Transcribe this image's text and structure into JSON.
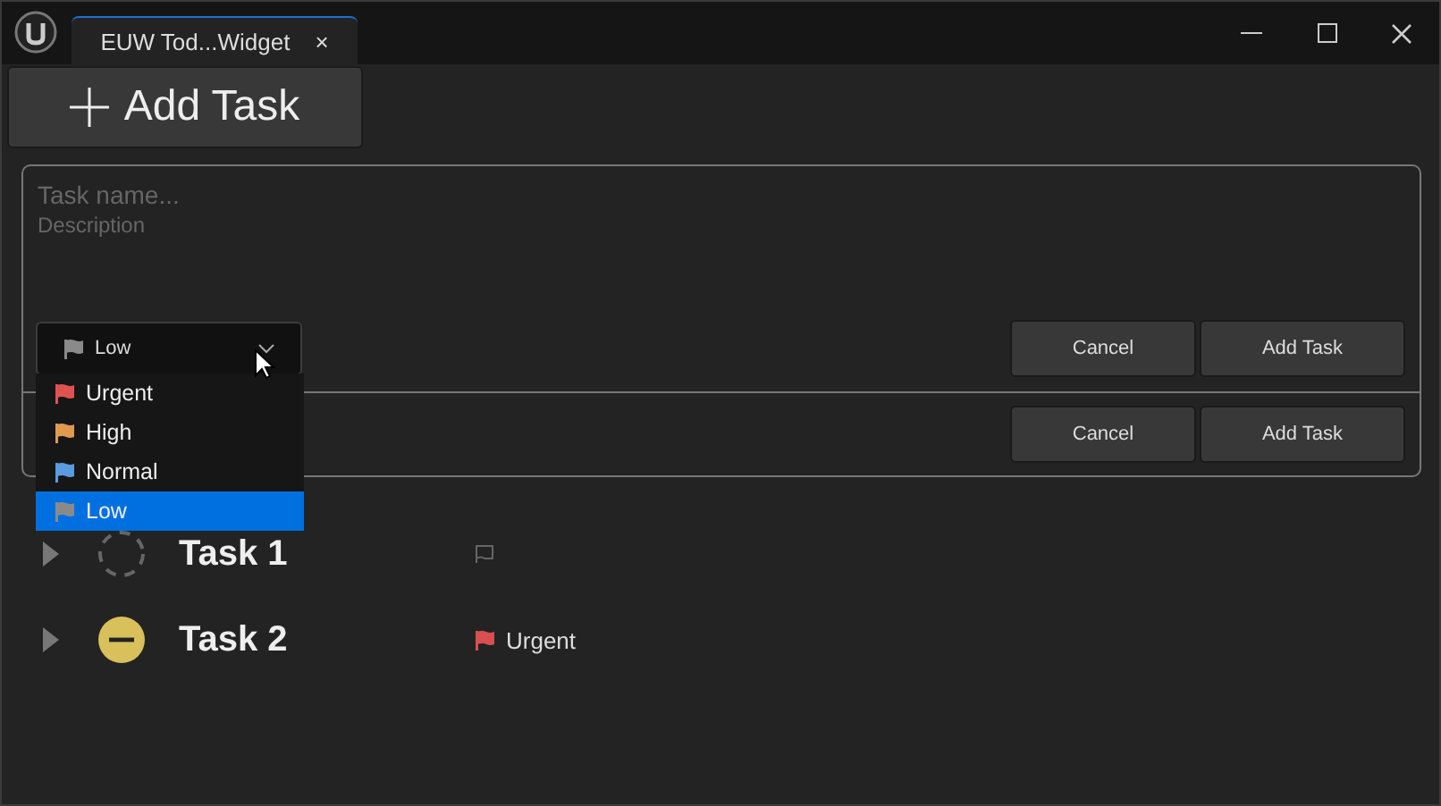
{
  "window": {
    "tab_title": "EUW Tod...Widget",
    "tab_close": "×"
  },
  "add_button": {
    "label": "Add Task"
  },
  "form": {
    "name_placeholder": "Task name...",
    "description_placeholder": "Description",
    "priority": {
      "value": "Low",
      "color": "#8a8a8a",
      "expanded": true,
      "options": [
        {
          "label": "Urgent",
          "color": "#e05252",
          "selected": false
        },
        {
          "label": "High",
          "color": "#e09a4f",
          "selected": false
        },
        {
          "label": "Normal",
          "color": "#5a9be0",
          "selected": false
        },
        {
          "label": "Low",
          "color": "#8a8a8a",
          "selected": true
        }
      ]
    },
    "rows": [
      {
        "cancel": "Cancel",
        "submit": "Add Task"
      },
      {
        "cancel": "Cancel",
        "submit": "Add Task"
      }
    ]
  },
  "tasks": [
    {
      "name": "Task 1",
      "kind": "pending"
    },
    {
      "name": "Task 2",
      "kind": "blocked",
      "priority": {
        "label": "Urgent",
        "color": "#d94f4f"
      }
    }
  ]
}
